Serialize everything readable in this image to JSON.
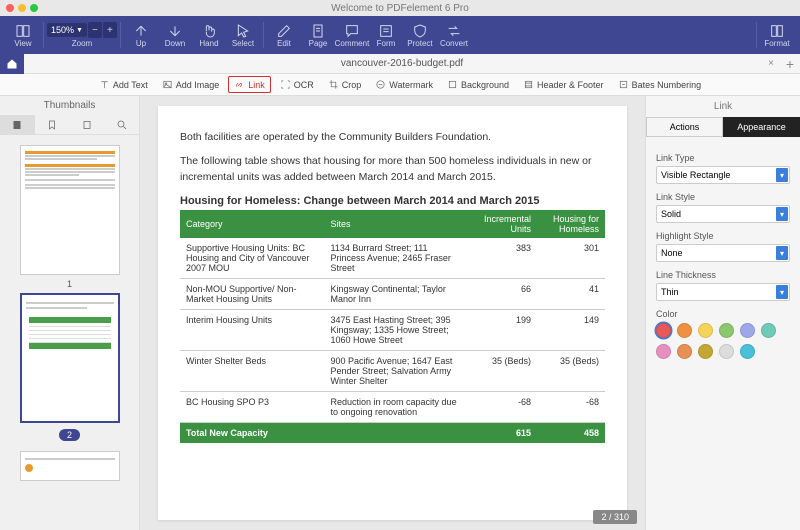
{
  "title": "Welcome to PDFelement 6 Pro",
  "toolbar": {
    "view": "View",
    "zoom_val": "150%",
    "zoom": "Zoom",
    "up": "Up",
    "down": "Down",
    "hand": "Hand",
    "select": "Select",
    "edit": "Edit",
    "page": "Page",
    "comment": "Comment",
    "form": "Form",
    "protect": "Protect",
    "convert": "Convert",
    "format": "Format"
  },
  "doc_tab": "vancouver-2016-budget.pdf",
  "subtoolbar": {
    "add_text": "Add Text",
    "add_image": "Add Image",
    "link": "Link",
    "ocr": "OCR",
    "crop": "Crop",
    "watermark": "Watermark",
    "background": "Background",
    "header_footer": "Header & Footer",
    "bates": "Bates Numbering"
  },
  "sidebar": {
    "title": "Thumbnails",
    "p1": "1",
    "p2": "2"
  },
  "page": {
    "para1": "Both facilities are operated by the Community Builders Foundation.",
    "para2": "The following table shows that housing for more than 500 homeless individuals in new or incremental units was added between March 2014 and March 2015.",
    "table_title": "Housing for Homeless: Change between March 2014 and March 2015",
    "headers": [
      "Category",
      "Sites",
      "Incremental Units",
      "Housing for Homeless"
    ],
    "rows": [
      {
        "cat": "Supportive Housing Units: BC Housing and City of Vancouver 2007 MOU",
        "site": "1134 Burrard Street; 111 Princess Avenue; 2465 Fraser Street",
        "inc": "383",
        "hom": "301"
      },
      {
        "cat": "Non-MOU Supportive/ Non-Market Housing Units",
        "site": "Kingsway Continental; Taylor Manor Inn",
        "inc": "66",
        "hom": "41"
      },
      {
        "cat": "Interim Housing Units",
        "site": "3475 East Hasting Street; 395 Kingsway; 1335 Howe Street; 1060 Howe Street",
        "inc": "199",
        "hom": "149"
      },
      {
        "cat": "Winter Shelter Beds",
        "site": "900 Pacific Avenue; 1647 East Pender Street; Salvation Army Winter Shelter",
        "inc": "35 (Beds)",
        "hom": "35 (Beds)"
      },
      {
        "cat": "BC Housing SPO P3",
        "site": "Reduction in room capacity due to ongoing renovation",
        "inc": "-68",
        "hom": "-68"
      }
    ],
    "total": {
      "label": "Total New Capacity",
      "inc": "615",
      "hom": "458"
    },
    "indicator": "2 / 310"
  },
  "rpanel": {
    "title": "Link",
    "tab_actions": "Actions",
    "tab_appearance": "Appearance",
    "link_type_lbl": "Link Type",
    "link_type": "Visible Rectangle",
    "link_style_lbl": "Link Style",
    "link_style": "Solid",
    "highlight_lbl": "Highlight Style",
    "highlight": "None",
    "thickness_lbl": "Line Thickness",
    "thickness": "Thin",
    "color_lbl": "Color",
    "colors": [
      "#e95858",
      "#f09042",
      "#f5d35a",
      "#8cc76f",
      "#9da8e8",
      "#6fcab8",
      "#e88fc2",
      "#e88f56",
      "#c4a732",
      "#dcdcdc",
      "#4abfd9"
    ]
  },
  "chart_data": {
    "type": "table",
    "title": "Housing for Homeless: Change between March 2014 and March 2015",
    "columns": [
      "Category",
      "Sites",
      "Incremental Units",
      "Housing for Homeless"
    ],
    "rows": [
      [
        "Supportive Housing Units: BC Housing and City of Vancouver 2007 MOU",
        "1134 Burrard Street; 111 Princess Avenue; 2465 Fraser Street",
        383,
        301
      ],
      [
        "Non-MOU Supportive/ Non-Market Housing Units",
        "Kingsway Continental; Taylor Manor Inn",
        66,
        41
      ],
      [
        "Interim Housing Units",
        "3475 East Hasting Street; 395 Kingsway; 1335 Howe Street; 1060 Howe Street",
        199,
        149
      ],
      [
        "Winter Shelter Beds",
        "900 Pacific Avenue; 1647 East Pender Street; Salvation Army Winter Shelter",
        "35 (Beds)",
        "35 (Beds)"
      ],
      [
        "BC Housing SPO P3",
        "Reduction in room capacity due to ongoing renovation",
        -68,
        -68
      ]
    ],
    "totals": [
      "Total New Capacity",
      "",
      615,
      458
    ]
  }
}
